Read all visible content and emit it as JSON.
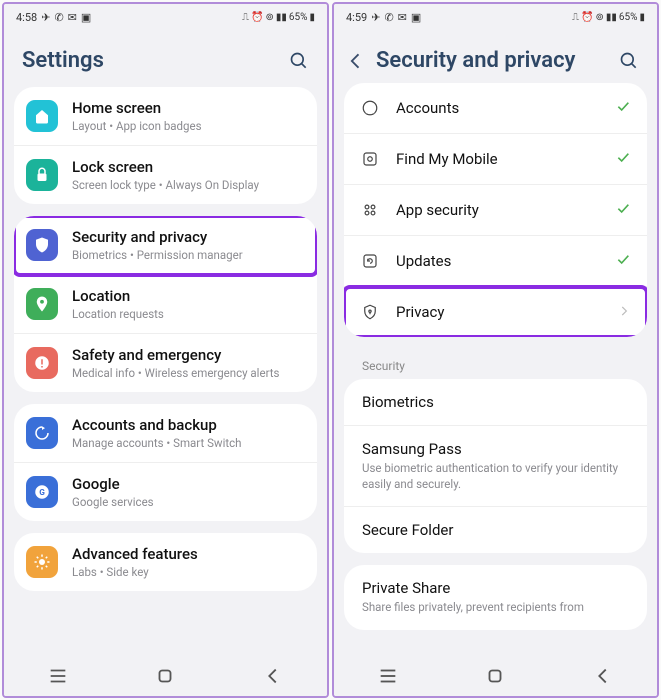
{
  "left": {
    "statusbar": {
      "time": "4:58",
      "battery": "65%"
    },
    "title": "Settings",
    "groups": [
      {
        "items": [
          {
            "id": "home-screen",
            "title": "Home screen",
            "subtitle": "Layout  •  App icon badges",
            "color": "#22c2d6"
          },
          {
            "id": "lock-screen",
            "title": "Lock screen",
            "subtitle": "Screen lock type  •  Always On Display",
            "color": "#1bb39a"
          }
        ]
      },
      {
        "items": [
          {
            "id": "security-privacy",
            "title": "Security and privacy",
            "subtitle": "Biometrics  •  Permission manager",
            "color": "#4f63d2",
            "highlight": true
          },
          {
            "id": "location",
            "title": "Location",
            "subtitle": "Location requests",
            "color": "#3fae5a"
          },
          {
            "id": "safety-emergency",
            "title": "Safety and emergency",
            "subtitle": "Medical info  •  Wireless emergency alerts",
            "color": "#e86a5f"
          }
        ]
      },
      {
        "items": [
          {
            "id": "accounts-backup",
            "title": "Accounts and backup",
            "subtitle": "Manage accounts  •  Smart Switch",
            "color": "#3a6fd8"
          },
          {
            "id": "google",
            "title": "Google",
            "subtitle": "Google services",
            "color": "#3a6fd8"
          }
        ]
      },
      {
        "items": [
          {
            "id": "advanced-features",
            "title": "Advanced features",
            "subtitle": "Labs  •  Side key",
            "color": "#f1a33c"
          }
        ]
      }
    ]
  },
  "right": {
    "statusbar": {
      "time": "4:59",
      "battery": "65%"
    },
    "title": "Security and privacy",
    "status_items": [
      {
        "id": "accounts",
        "label": "Accounts",
        "icon": "user"
      },
      {
        "id": "find-my-mobile",
        "label": "Find My Mobile",
        "icon": "target"
      },
      {
        "id": "app-security",
        "label": "App security",
        "icon": "grid"
      },
      {
        "id": "updates",
        "label": "Updates",
        "icon": "refresh"
      },
      {
        "id": "privacy",
        "label": "Privacy",
        "icon": "shield",
        "chevron": true,
        "highlight": true
      }
    ],
    "section_label": "Security",
    "security_items": [
      {
        "id": "biometrics",
        "title": "Biometrics"
      },
      {
        "id": "samsung-pass",
        "title": "Samsung Pass",
        "subtitle": "Use biometric authentication to verify your identity easily and securely."
      },
      {
        "id": "secure-folder",
        "title": "Secure Folder"
      }
    ],
    "extra_items": [
      {
        "id": "private-share",
        "title": "Private Share",
        "subtitle": "Share files privately, prevent recipients from"
      }
    ]
  }
}
